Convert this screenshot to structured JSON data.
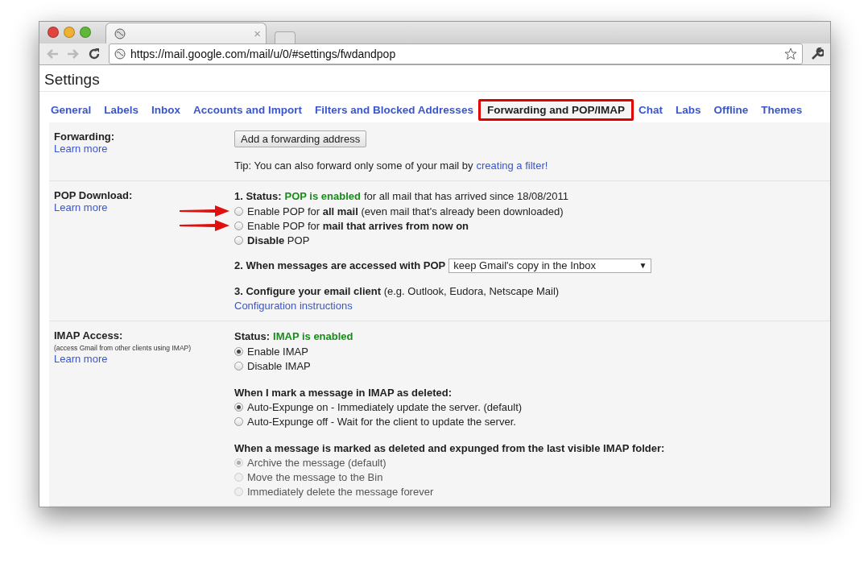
{
  "browser": {
    "tab_close": "×",
    "url": "https://mail.google.com/mail/u/0/#settings/fwdandpop"
  },
  "page_title": "Settings",
  "tabs": [
    {
      "label": "General",
      "selected": false
    },
    {
      "label": "Labels",
      "selected": false
    },
    {
      "label": "Inbox",
      "selected": false
    },
    {
      "label": "Accounts and Import",
      "selected": false
    },
    {
      "label": "Filters and Blocked Addresses",
      "selected": false
    },
    {
      "label": "Forwarding and POP/IMAP",
      "selected": true
    },
    {
      "label": "Chat",
      "selected": false
    },
    {
      "label": "Labs",
      "selected": false
    },
    {
      "label": "Offline",
      "selected": false
    },
    {
      "label": "Themes",
      "selected": false
    }
  ],
  "sections": [
    {
      "label": "Forwarding:",
      "learn_more": "Learn more",
      "blocks": [
        {
          "kind": "button",
          "label": "Add a forwarding address"
        },
        {
          "kind": "tip",
          "text": "Tip: You can also forward only some of your mail by",
          "link": "creating a filter!"
        }
      ]
    },
    {
      "label": "POP Download:",
      "learn_more": "Learn more",
      "blocks": [
        {
          "kind": "status",
          "prefix": "1. Status:",
          "value": "POP is enabled",
          "suffix": "for all mail that has arrived since 18/08/2011"
        },
        {
          "kind": "radios",
          "options": [
            {
              "text": "Enable POP for **all mail** (even mail that's already been downloaded)",
              "checked": false,
              "disabled": false,
              "arrow": true
            },
            {
              "text": "Enable POP for **mail that arrives from now on**",
              "checked": false,
              "disabled": false,
              "arrow": true
            },
            {
              "text": "**Disable** POP",
              "checked": false,
              "disabled": false,
              "arrow": false
            }
          ]
        },
        {
          "kind": "select",
          "label": "2. When messages are accessed with POP",
          "value": "keep Gmail's copy in the Inbox",
          "caret": "▼"
        },
        {
          "kind": "text",
          "text": "**3. Configure your email client** (e.g. Outlook, Eudora, Netscape Mail)",
          "link": "Configuration instructions"
        }
      ]
    },
    {
      "label": "IMAP Access:",
      "note": "(access Gmail from other clients using IMAP)",
      "learn_more": "Learn more",
      "blocks": [
        {
          "kind": "status",
          "prefix": "Status:",
          "value": "IMAP is enabled"
        },
        {
          "kind": "radios",
          "options": [
            {
              "text": "Enable IMAP",
              "checked": true,
              "disabled": false,
              "arrow": false
            },
            {
              "text": "Disable IMAP",
              "checked": false,
              "disabled": false,
              "arrow": false
            }
          ]
        },
        {
          "kind": "heading",
          "text": "When I mark a message in IMAP as deleted:"
        },
        {
          "kind": "radios",
          "options": [
            {
              "text": "Auto-Expunge on - Immediately update the server. (default)",
              "checked": true,
              "disabled": false,
              "arrow": false
            },
            {
              "text": "Auto-Expunge off - Wait for the client to update the server.",
              "checked": false,
              "disabled": false,
              "arrow": false
            }
          ]
        },
        {
          "kind": "heading",
          "text": "When a message is marked as deleted and expunged from the last visible IMAP folder:"
        },
        {
          "kind": "radios",
          "options": [
            {
              "text": "Archive the message (default)",
              "checked": true,
              "disabled": true,
              "arrow": false
            },
            {
              "text": "Move the message to the Bin",
              "checked": false,
              "disabled": true,
              "arrow": false
            },
            {
              "text": "Immediately delete the message forever",
              "checked": false,
              "disabled": true,
              "arrow": false
            }
          ]
        }
      ]
    }
  ]
}
